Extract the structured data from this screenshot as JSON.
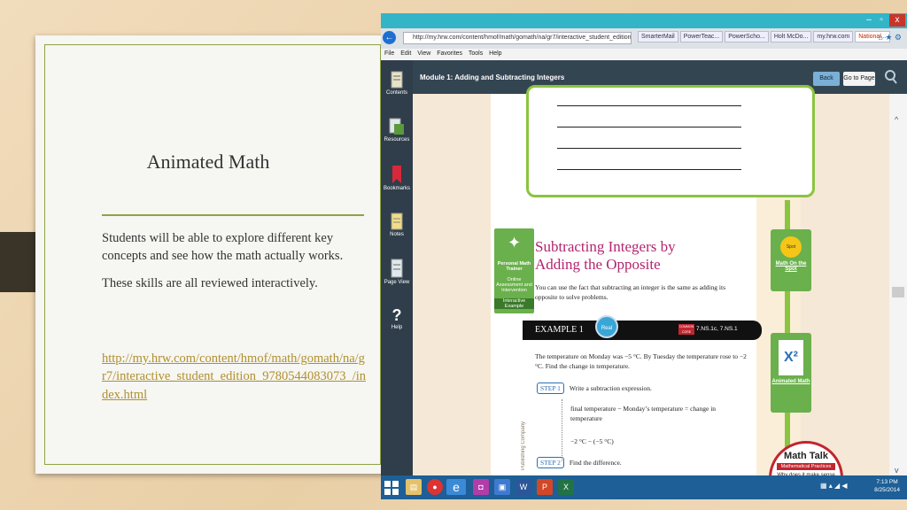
{
  "slide": {
    "title": "Animated Math",
    "paragraph1": "Students will be able to explore different key concepts and see how the math actually works.",
    "paragraph2": "These skills are all reviewed interactively.",
    "link": "http://my.hrw.com/content/hmof/math/gomath/na/gr7/interactive_student_edition_9780544083073_/index.html"
  },
  "browser": {
    "url": "http://my.hrw.com/content/hmof/math/gomath/na/gr7/interactive_student_edition_97805440(",
    "tabs": [
      "SmarterMail",
      "PowerTeac...",
      "PowerScho...",
      "Holt McDo...",
      "my.hrw.com",
      "National..."
    ],
    "menu": [
      "File",
      "Edit",
      "View",
      "Favorites",
      "Tools",
      "Help"
    ]
  },
  "app": {
    "module_title": "Module 1: Adding and Subtracting Integers",
    "back_label": "Back",
    "goto_label": "Go to Page",
    "sidebar": [
      "Contents",
      "Resources",
      "Bookmarks",
      "Notes",
      "Page View",
      "Help"
    ]
  },
  "page": {
    "trainer_label": "Personal Math Trainer",
    "trainer_sub": "Online Assessment and Intervention",
    "trainer_tag": "Interactive Example",
    "section_title": "Subtracting Integers by Adding the Opposite",
    "section_text": "You can use the fact that subtracting an integer is the same as adding its opposite to solve problems.",
    "example_label": "EXAMPLE 1",
    "example_std": "7.NS.1c, 7.NS.1",
    "common_core": "COMMON CORE",
    "example_text": "The temperature on Monday was −5 °C. By Tuesday the temperature rose to −2 °C. Find the change in temperature.",
    "step1": "STEP 1",
    "step1_text": "Write a subtraction expression.",
    "step1_line1": "final temperature − Monday’s temperature = change in temperature",
    "step1_line2": "−2 °C − (−5 °C)",
    "step2": "STEP 2",
    "step2_text": "Find the difference.",
    "publisher": "Publishing Company",
    "math_on_spot": "Math On the Spot",
    "animated_math": "Animated Math",
    "math_talk": "Math Talk",
    "math_practices": "Mathematical Practices",
    "math_talk_q": "Why does it make sense"
  },
  "taskbar": {
    "time": "7:13 PM",
    "date": "8/25/2014"
  }
}
